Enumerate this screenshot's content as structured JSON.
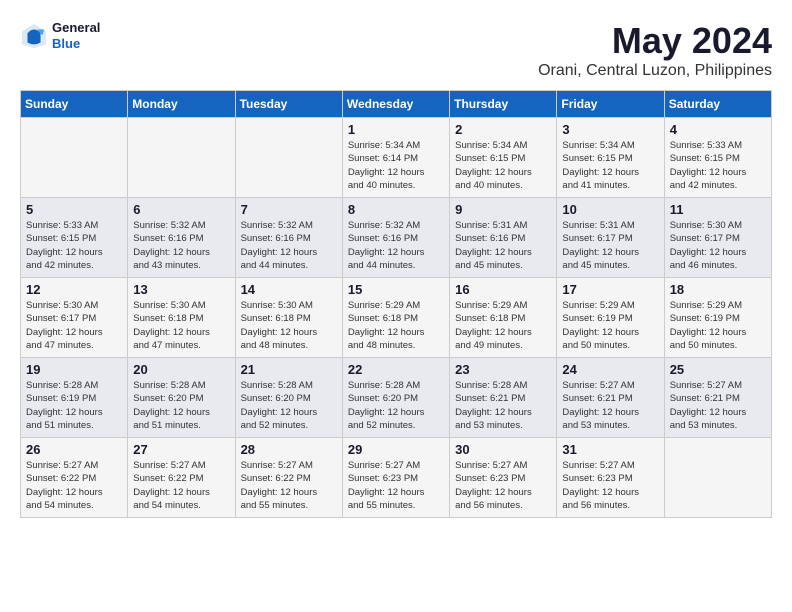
{
  "header": {
    "logo_general": "General",
    "logo_blue": "Blue",
    "month_year": "May 2024",
    "location": "Orani, Central Luzon, Philippines"
  },
  "weekdays": [
    "Sunday",
    "Monday",
    "Tuesday",
    "Wednesday",
    "Thursday",
    "Friday",
    "Saturday"
  ],
  "weeks": [
    [
      {
        "day": "",
        "text": ""
      },
      {
        "day": "",
        "text": ""
      },
      {
        "day": "",
        "text": ""
      },
      {
        "day": "1",
        "text": "Sunrise: 5:34 AM\nSunset: 6:14 PM\nDaylight: 12 hours\nand 40 minutes."
      },
      {
        "day": "2",
        "text": "Sunrise: 5:34 AM\nSunset: 6:15 PM\nDaylight: 12 hours\nand 40 minutes."
      },
      {
        "day": "3",
        "text": "Sunrise: 5:34 AM\nSunset: 6:15 PM\nDaylight: 12 hours\nand 41 minutes."
      },
      {
        "day": "4",
        "text": "Sunrise: 5:33 AM\nSunset: 6:15 PM\nDaylight: 12 hours\nand 42 minutes."
      }
    ],
    [
      {
        "day": "5",
        "text": "Sunrise: 5:33 AM\nSunset: 6:15 PM\nDaylight: 12 hours\nand 42 minutes."
      },
      {
        "day": "6",
        "text": "Sunrise: 5:32 AM\nSunset: 6:16 PM\nDaylight: 12 hours\nand 43 minutes."
      },
      {
        "day": "7",
        "text": "Sunrise: 5:32 AM\nSunset: 6:16 PM\nDaylight: 12 hours\nand 44 minutes."
      },
      {
        "day": "8",
        "text": "Sunrise: 5:32 AM\nSunset: 6:16 PM\nDaylight: 12 hours\nand 44 minutes."
      },
      {
        "day": "9",
        "text": "Sunrise: 5:31 AM\nSunset: 6:16 PM\nDaylight: 12 hours\nand 45 minutes."
      },
      {
        "day": "10",
        "text": "Sunrise: 5:31 AM\nSunset: 6:17 PM\nDaylight: 12 hours\nand 45 minutes."
      },
      {
        "day": "11",
        "text": "Sunrise: 5:30 AM\nSunset: 6:17 PM\nDaylight: 12 hours\nand 46 minutes."
      }
    ],
    [
      {
        "day": "12",
        "text": "Sunrise: 5:30 AM\nSunset: 6:17 PM\nDaylight: 12 hours\nand 47 minutes."
      },
      {
        "day": "13",
        "text": "Sunrise: 5:30 AM\nSunset: 6:18 PM\nDaylight: 12 hours\nand 47 minutes."
      },
      {
        "day": "14",
        "text": "Sunrise: 5:30 AM\nSunset: 6:18 PM\nDaylight: 12 hours\nand 48 minutes."
      },
      {
        "day": "15",
        "text": "Sunrise: 5:29 AM\nSunset: 6:18 PM\nDaylight: 12 hours\nand 48 minutes."
      },
      {
        "day": "16",
        "text": "Sunrise: 5:29 AM\nSunset: 6:18 PM\nDaylight: 12 hours\nand 49 minutes."
      },
      {
        "day": "17",
        "text": "Sunrise: 5:29 AM\nSunset: 6:19 PM\nDaylight: 12 hours\nand 50 minutes."
      },
      {
        "day": "18",
        "text": "Sunrise: 5:29 AM\nSunset: 6:19 PM\nDaylight: 12 hours\nand 50 minutes."
      }
    ],
    [
      {
        "day": "19",
        "text": "Sunrise: 5:28 AM\nSunset: 6:19 PM\nDaylight: 12 hours\nand 51 minutes."
      },
      {
        "day": "20",
        "text": "Sunrise: 5:28 AM\nSunset: 6:20 PM\nDaylight: 12 hours\nand 51 minutes."
      },
      {
        "day": "21",
        "text": "Sunrise: 5:28 AM\nSunset: 6:20 PM\nDaylight: 12 hours\nand 52 minutes."
      },
      {
        "day": "22",
        "text": "Sunrise: 5:28 AM\nSunset: 6:20 PM\nDaylight: 12 hours\nand 52 minutes."
      },
      {
        "day": "23",
        "text": "Sunrise: 5:28 AM\nSunset: 6:21 PM\nDaylight: 12 hours\nand 53 minutes."
      },
      {
        "day": "24",
        "text": "Sunrise: 5:27 AM\nSunset: 6:21 PM\nDaylight: 12 hours\nand 53 minutes."
      },
      {
        "day": "25",
        "text": "Sunrise: 5:27 AM\nSunset: 6:21 PM\nDaylight: 12 hours\nand 53 minutes."
      }
    ],
    [
      {
        "day": "26",
        "text": "Sunrise: 5:27 AM\nSunset: 6:22 PM\nDaylight: 12 hours\nand 54 minutes."
      },
      {
        "day": "27",
        "text": "Sunrise: 5:27 AM\nSunset: 6:22 PM\nDaylight: 12 hours\nand 54 minutes."
      },
      {
        "day": "28",
        "text": "Sunrise: 5:27 AM\nSunset: 6:22 PM\nDaylight: 12 hours\nand 55 minutes."
      },
      {
        "day": "29",
        "text": "Sunrise: 5:27 AM\nSunset: 6:23 PM\nDaylight: 12 hours\nand 55 minutes."
      },
      {
        "day": "30",
        "text": "Sunrise: 5:27 AM\nSunset: 6:23 PM\nDaylight: 12 hours\nand 56 minutes."
      },
      {
        "day": "31",
        "text": "Sunrise: 5:27 AM\nSunset: 6:23 PM\nDaylight: 12 hours\nand 56 minutes."
      },
      {
        "day": "",
        "text": ""
      }
    ]
  ]
}
